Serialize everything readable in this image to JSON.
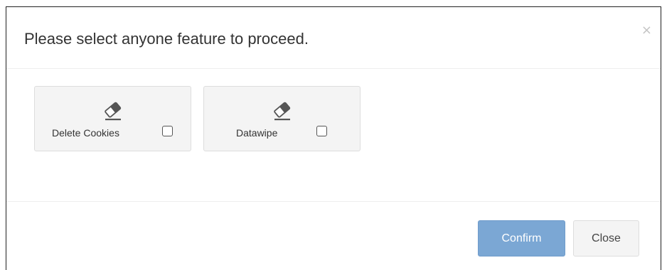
{
  "dialog": {
    "title": "Please select anyone feature to proceed.",
    "close_glyph": "×"
  },
  "features": [
    {
      "label": "Delete Cookies",
      "icon": "eraser-icon",
      "checked": false
    },
    {
      "label": "Datawipe",
      "icon": "eraser-icon",
      "checked": false
    }
  ],
  "footer": {
    "confirm_label": "Confirm",
    "close_label": "Close"
  },
  "colors": {
    "confirm_bg": "#7ba7d4",
    "card_bg": "#f4f4f4",
    "icon": "#555555"
  }
}
